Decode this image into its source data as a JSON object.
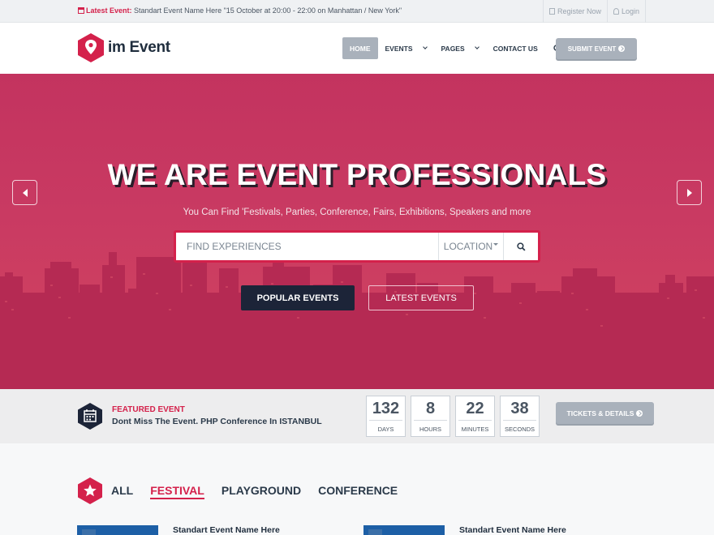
{
  "topbar": {
    "latest_label": "Latest Event:",
    "latest_text": "Standart Event Name Here \"15 October at 20:00 - 22:00 on Manhattan / New York\"",
    "register": "Register Now",
    "login": "Login"
  },
  "header": {
    "logo_text": "im Event",
    "nav": {
      "home": "HOME",
      "events": "EVENTS",
      "pages": "PAGES",
      "contact": "CONTACT US"
    },
    "submit_label": "SUBMIT EVENT"
  },
  "hero": {
    "title": "WE ARE EVENT PROFESSIONALS",
    "subtitle": "You Can Find 'Festivals, Parties, Conference, Fairs, Exhibitions, Speakers and more",
    "search_placeholder": "FIND EXPERIENCES",
    "location_label": "LOCATION",
    "popular_label": "POPULAR EVENTS",
    "latest_label": "LATEST EVENTS"
  },
  "featured": {
    "label": "FEATURED EVENT",
    "description": "Dont Miss The Event. PHP Conference In ISTANBUL",
    "countdown": [
      {
        "value": "132",
        "unit": "DAYS"
      },
      {
        "value": "8",
        "unit": "HOURS"
      },
      {
        "value": "22",
        "unit": "MINUTES"
      },
      {
        "value": "38",
        "unit": "SECONDS"
      }
    ],
    "tickets_label": "TICKETS & DETAILS"
  },
  "filters": {
    "tabs": [
      "ALL",
      "FESTIVAL",
      "PLAYGROUND",
      "CONFERENCE"
    ],
    "active_tab": "FESTIVAL"
  },
  "events": [
    {
      "title": "Standart Event Name Here"
    },
    {
      "title": "Standart Event Name Here"
    }
  ],
  "colors": {
    "accent": "#d4214b",
    "hero_bg": "#c5315d",
    "dark_navy": "#1c2438",
    "button_gray": "#a9b1bb"
  }
}
